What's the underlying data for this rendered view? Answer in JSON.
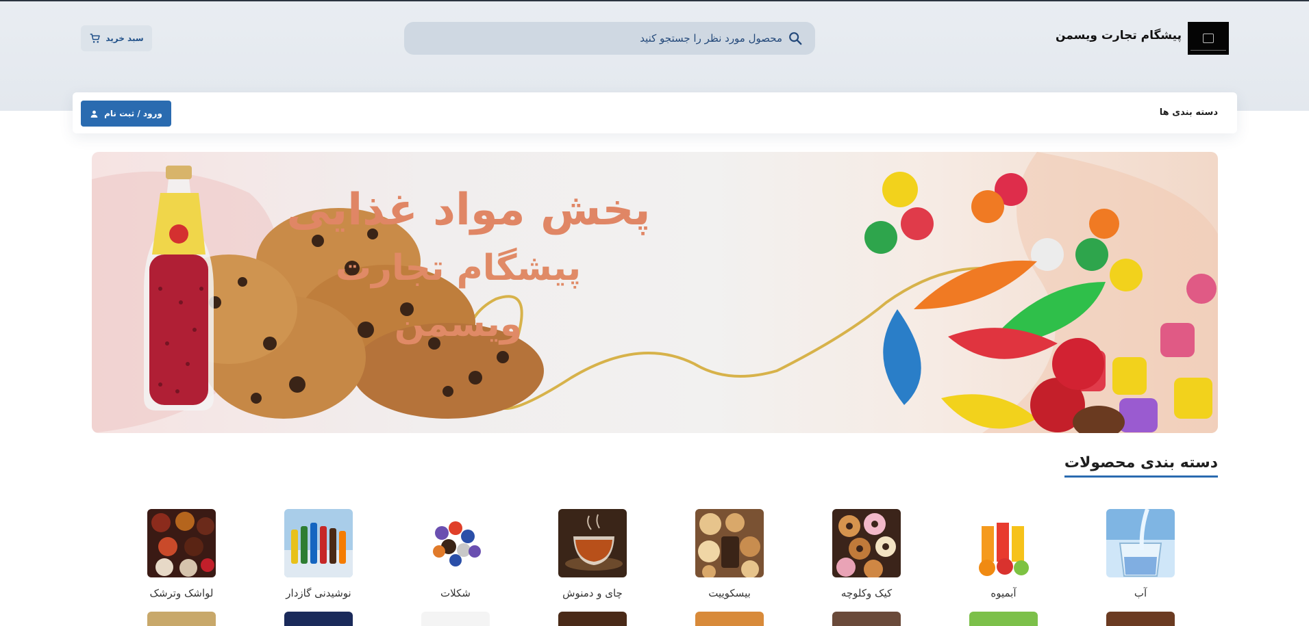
{
  "header": {
    "site_name": "پیشگام تجارت ویسمن",
    "search_placeholder": "محصول مورد نظر را جستجو کنید",
    "cart_label": "سبد خرید"
  },
  "nav": {
    "categories_label": "دسته بندی ها",
    "login_label": "ورود / ثبت نام"
  },
  "banner": {
    "line1": "پخش مواد غذایی",
    "line2": "پیشگام تجارت",
    "line3": "ویسمن"
  },
  "categories_section": {
    "title": "دسته بندی محصولات",
    "items": [
      {
        "label": "آب",
        "icon": "water-image"
      },
      {
        "label": "آبمیوه",
        "icon": "juice-image"
      },
      {
        "label": "کیک وکلوچه",
        "icon": "donuts-image"
      },
      {
        "label": "بیسکوییت",
        "icon": "biscuits-image"
      },
      {
        "label": "چای و دمنوش",
        "icon": "tea-image"
      },
      {
        "label": "شکلات",
        "icon": "chocolates-image"
      },
      {
        "label": "نوشیدنی گازدار",
        "icon": "soda-bottles-image"
      },
      {
        "label": "لواشک وترشک",
        "icon": "fruit-leather-image"
      }
    ]
  },
  "colors": {
    "accent": "#2a6bb0",
    "header_bg": "#e6ebf0",
    "search_bg": "#cfd8e2",
    "banner_text": "#e08665"
  }
}
